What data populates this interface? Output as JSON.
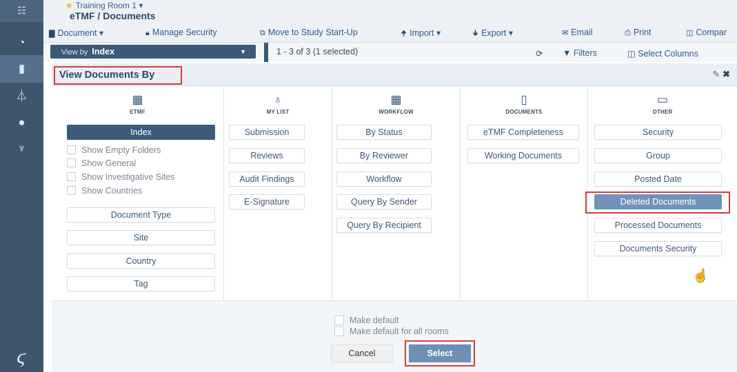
{
  "rail": {
    "icons": [
      "grid-icon",
      "dashboard-icon",
      "document-icon",
      "flask-icon",
      "user-icon",
      "trophy-icon"
    ]
  },
  "header": {
    "room": "Training Room 1",
    "room_caret": "▾",
    "path": "eTMF / Documents"
  },
  "toolbar": {
    "document": "Document ▾",
    "manage_security": "Manage Security",
    "move": "Move to Study Start-Up",
    "import": "Import ▾",
    "export": "Export ▾",
    "email": "Email",
    "print": "Print",
    "compare": "Compar"
  },
  "row2": {
    "view_by_prefix": "View by",
    "view_by_value": "Index",
    "count": "1 - 3 of 3 (1 selected)",
    "filters": "Filters",
    "select_columns": "Select Columns"
  },
  "dialog": {
    "title": "View Documents By",
    "columns": [
      {
        "label": "ETMF",
        "icon": "building-icon",
        "options": [
          "Index",
          "Document Type",
          "Site",
          "Country",
          "Tag"
        ],
        "checkboxes": [
          "Show Empty Folders",
          "Show General",
          "Show Investigative Sites",
          "Show Countries"
        ]
      },
      {
        "label": "MY LIST",
        "icon": "user-outline-icon",
        "options": [
          "Submission",
          "Reviews",
          "Audit Findings",
          "E-Signature"
        ]
      },
      {
        "label": "WORKFLOW",
        "icon": "calendar-icon",
        "options": [
          "By Status",
          "By Reviewer",
          "Workflow",
          "Query By Sender",
          "Query By Recipient"
        ]
      },
      {
        "label": "DOCUMENTS",
        "icon": "file-icon",
        "options": [
          "eTMF Completeness",
          "Working Documents"
        ]
      },
      {
        "label": "OTHER",
        "icon": "folder-icon",
        "options": [
          "Security",
          "Group",
          "Posted Date",
          "Deleted Documents",
          "Processed Documents",
          "Documents Security"
        ]
      }
    ],
    "footer": {
      "make_default": "Make default",
      "make_default_all": "Make default for all rooms",
      "cancel": "Cancel",
      "select": "Select"
    }
  },
  "colors": {
    "rail": "#3f556c",
    "selected": "#3c5b7c",
    "highlight": "#6f93bb",
    "callout": "#d63b3b"
  }
}
